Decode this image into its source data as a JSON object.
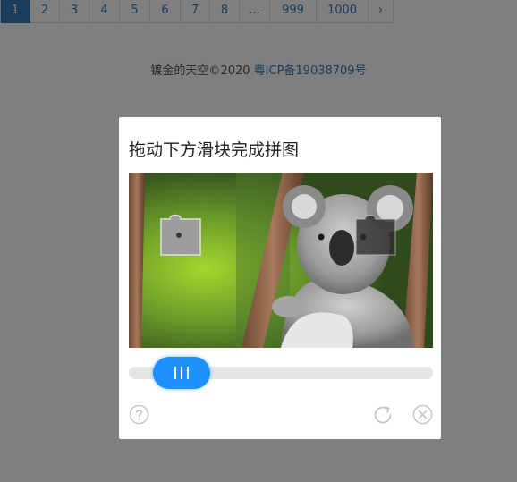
{
  "pagination": {
    "pages": [
      "1",
      "2",
      "3",
      "4",
      "5",
      "6",
      "7",
      "8",
      "...",
      "999",
      "1000",
      "›"
    ],
    "active": "1"
  },
  "footer": {
    "copyright": "镀金的天空©2020",
    "icp": "粤ICP备19038709号"
  },
  "captcha": {
    "title": "拖动下方滑块完成拼图",
    "slider_progress": 0.08,
    "colors": {
      "accent": "#1e90ff",
      "track": "#e5e5e5",
      "overlay": "rgba(0,0,0,0.5)"
    },
    "icons": [
      "question-icon",
      "refresh-icon",
      "close-icon"
    ]
  }
}
